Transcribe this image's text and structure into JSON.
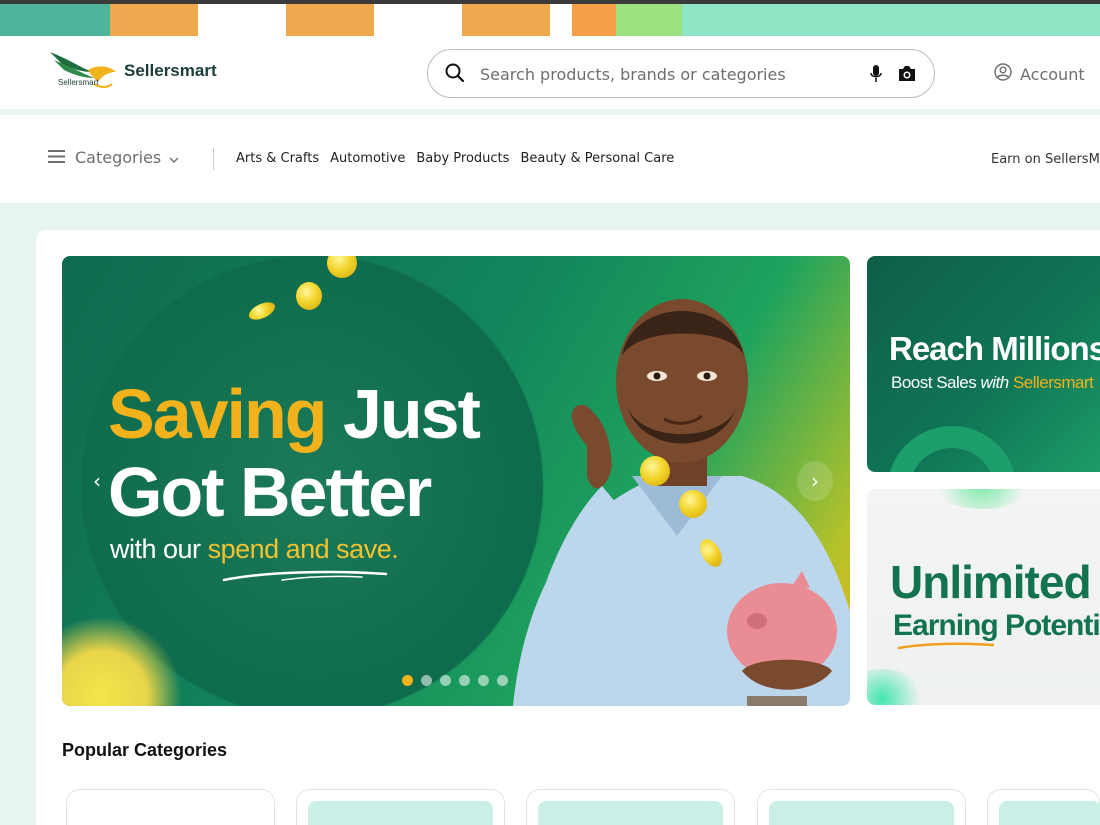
{
  "brand": {
    "name": "Sellersmart",
    "mark_text": "Sellersmart"
  },
  "search": {
    "placeholder": "Search products, brands or categories"
  },
  "account": {
    "label": "Account"
  },
  "nav": {
    "categories_label": "Categories",
    "links": [
      "Arts & Crafts",
      "Automotive",
      "Baby Products",
      "Beauty & Personal Care"
    ],
    "earn_label": "Earn on SellersMa"
  },
  "hero": {
    "line1_highlight": "Saving",
    "line1_rest": "Just",
    "line2": "Got Better",
    "sub_plain": "with our",
    "sub_highlight": "spend and save.",
    "slide_count": 6,
    "active_slide": 1
  },
  "side_banner_1": {
    "headline": "Reach Millions",
    "sub_plain": "Boost Sales",
    "sub_script": "with",
    "sub_brand": "Sellersmart"
  },
  "side_banner_2": {
    "headline": "Unlimited",
    "sub": "Earning Potenti"
  },
  "popular": {
    "title": "Popular Categories",
    "card_count": 5
  },
  "colors": {
    "brand_green": "#13734f",
    "accent_yellow": "#f2b21b",
    "page_bg": "#e8f4f0"
  },
  "icons": [
    "search-icon",
    "microphone-icon",
    "camera-icon",
    "user-circle-icon",
    "hamburger-icon",
    "chevron-down-icon",
    "chevron-left-icon",
    "chevron-right-icon"
  ]
}
